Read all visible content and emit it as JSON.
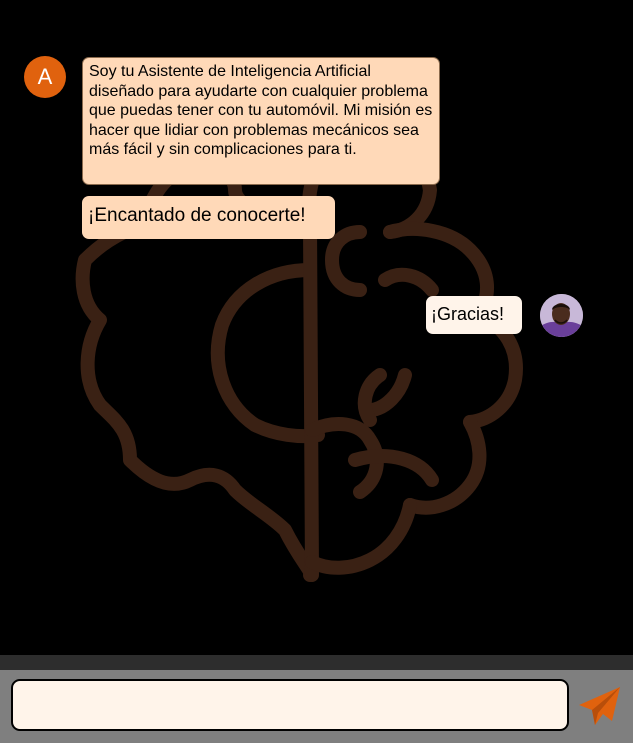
{
  "colors": {
    "background": "#000000",
    "bubble": "#ffd9b8",
    "user_bubble": "#fff4ea",
    "accent": "#e0620e",
    "art_stroke": "#3a2114",
    "input_bar": "#7f7f7f"
  },
  "chat": {
    "assistant": {
      "avatar_letter": "A",
      "messages": [
        "Soy tu Asistente de Inteligencia Artificial diseñado para ayudarte con cualquier problema que puedas tener con tu automóvil. Mi misión es hacer que lidiar con problemas mecánicos sea más fácil y sin complicaciones para ti.",
        "¡Encantado de conocerte!"
      ]
    },
    "user": {
      "messages": [
        "¡Gracias!"
      ],
      "avatar": "user-photo-avatar"
    }
  },
  "composer": {
    "value": "",
    "placeholder": "",
    "send_icon": "paper-plane-icon"
  },
  "background_art": "brain-gear-icon"
}
